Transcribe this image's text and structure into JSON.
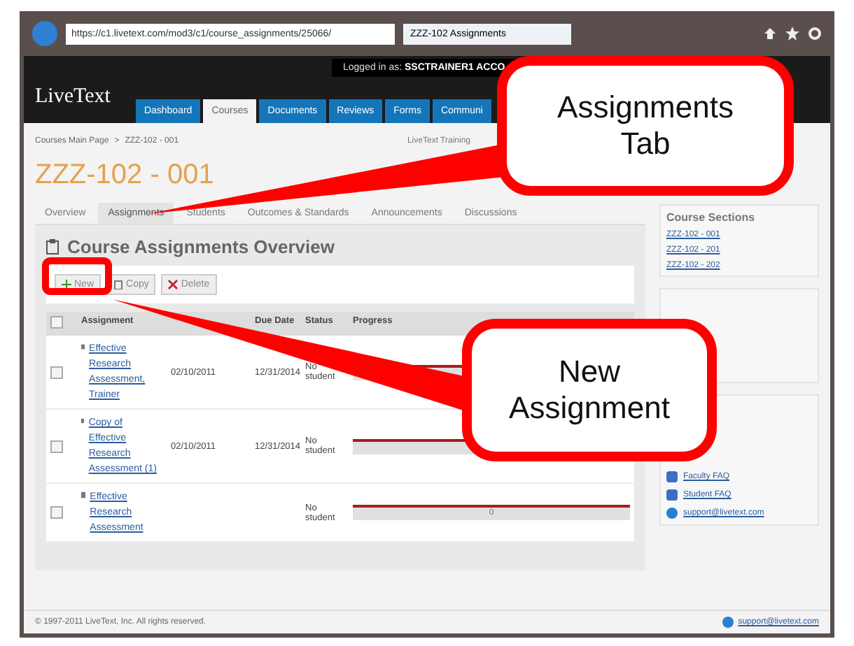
{
  "browser": {
    "url": "https://c1.livetext.com/mod3/c1/course_assignments/25066/",
    "tab": "ZZZ-102 Assignments"
  },
  "header": {
    "logo": "LiveText",
    "logged_in": "Logged in as:",
    "user": "SSCTRAINER1 ACCO",
    "nav": [
      {
        "label": "Dashboard",
        "selected": false
      },
      {
        "label": "Courses",
        "selected": true
      },
      {
        "label": "Documents",
        "selected": false
      },
      {
        "label": "Reviews",
        "selected": false
      },
      {
        "label": "Forms",
        "selected": false
      },
      {
        "label": "Communi",
        "selected": false
      }
    ]
  },
  "breadcrumb": {
    "items": [
      "Courses Main Page",
      "ZZZ-102 - 001"
    ],
    "separator": ">"
  },
  "org_label": "LiveText Training",
  "course_title": "ZZZ-102 - 001",
  "tabs": [
    {
      "label": "Overview",
      "selected": false
    },
    {
      "label": "Assignments",
      "selected": true
    },
    {
      "label": "Students",
      "selected": false
    },
    {
      "label": "Outcomes & Standards",
      "selected": false
    },
    {
      "label": "Announcements",
      "selected": false
    },
    {
      "label": "Discussions",
      "selected": false
    }
  ],
  "panel": {
    "title": "Course Assignments Overview",
    "buttons": [
      {
        "label": "New",
        "kind": "new"
      },
      {
        "label": "Copy",
        "kind": "copy"
      },
      {
        "label": "Delete",
        "kind": "delete"
      }
    ]
  },
  "table": {
    "select_all_checked": false,
    "columns": {
      "assignment": "Assignment",
      "due_date": "Due Date",
      "status": "Status",
      "progress": "Progress"
    },
    "rows": [
      {
        "title": "Effective Research Assessment, Trainer",
        "date": "02/10/2011",
        "due_date": "12/31/2014",
        "status": "No student",
        "level": 1,
        "checked": false
      },
      {
        "title": "Copy of Effective Research Assessment (1)",
        "date": "02/10/2011",
        "due_date": "12/31/2014",
        "status": "No student",
        "level": 1,
        "checked": false
      },
      {
        "title": "Effective Research Assessment",
        "status": "No student",
        "progress_label": "0",
        "level": 1,
        "checked": false
      }
    ]
  },
  "sidebar": {
    "sections_title": "Course Sections",
    "sections": [
      "ZZZ-102 - 001",
      "ZZZ-102 - 201",
      "ZZZ-102 - 202"
    ],
    "resources": [
      {
        "label": "Faculty FAQ",
        "kind": "doc"
      },
      {
        "label": "Student FAQ",
        "kind": "doc"
      },
      {
        "label": "support@livetext.com",
        "kind": "help"
      }
    ]
  },
  "footer": {
    "copyright": "© 1997-2011 LiveText, Inc. All rights reserved.",
    "support": "support@livetext.com"
  },
  "callouts": [
    {
      "text": "Assignments Tab"
    },
    {
      "text": "New Assignment"
    }
  ]
}
